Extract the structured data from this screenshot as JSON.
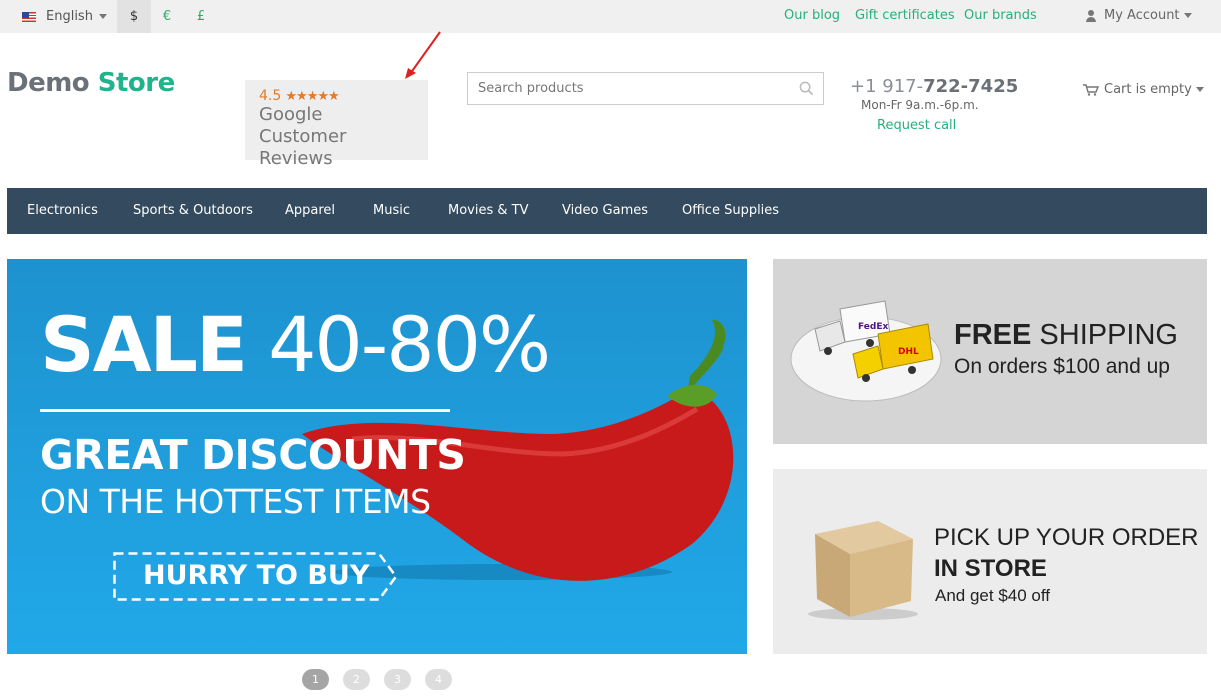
{
  "topbar": {
    "language": "English",
    "currencies": [
      "$",
      "€",
      "£"
    ],
    "links": [
      "Our blog",
      "Gift certificates",
      "Our brands"
    ],
    "account": "My Account"
  },
  "header": {
    "logo_part1": "Demo",
    "logo_part2": "Store",
    "reviews": {
      "rating": "4.5",
      "stars": "★★★★★",
      "line1": "Google",
      "line2": "Customer Reviews"
    },
    "search_placeholder": "Search products",
    "phone_prefix": "+1 917-",
    "phone_main": "722-7425",
    "hours": "Mon-Fr 9a.m.-6p.m.",
    "request_call": "Request call",
    "cart": "Cart is empty"
  },
  "nav": {
    "items": [
      "Electronics",
      "Sports & Outdoors",
      "Apparel",
      "Music",
      "Movies & TV",
      "Video Games",
      "Office Supplies"
    ]
  },
  "hero": {
    "sale_bold": "SALE",
    "sale_range": "40-80%",
    "line1": "GREAT DISCOUNTS",
    "line2": "ON THE HOTTEST ITEMS",
    "cta": "HURRY TO BUY"
  },
  "shipping": {
    "title_bold": "FREE",
    "title_rest": "SHIPPING",
    "subtitle": "On orders $100 and up",
    "truck_label_1": "FedEx",
    "truck_label_2": "DHL"
  },
  "pickup": {
    "line1": "PICK UP YOUR ORDER",
    "line2": "IN STORE",
    "line3": "And get $40 off"
  },
  "pagination": [
    "1",
    "2",
    "3",
    "4"
  ],
  "colors": {
    "accent": "#26b07c",
    "nav_bg": "#334a5f",
    "hero_bg": "#1e9bd8"
  }
}
